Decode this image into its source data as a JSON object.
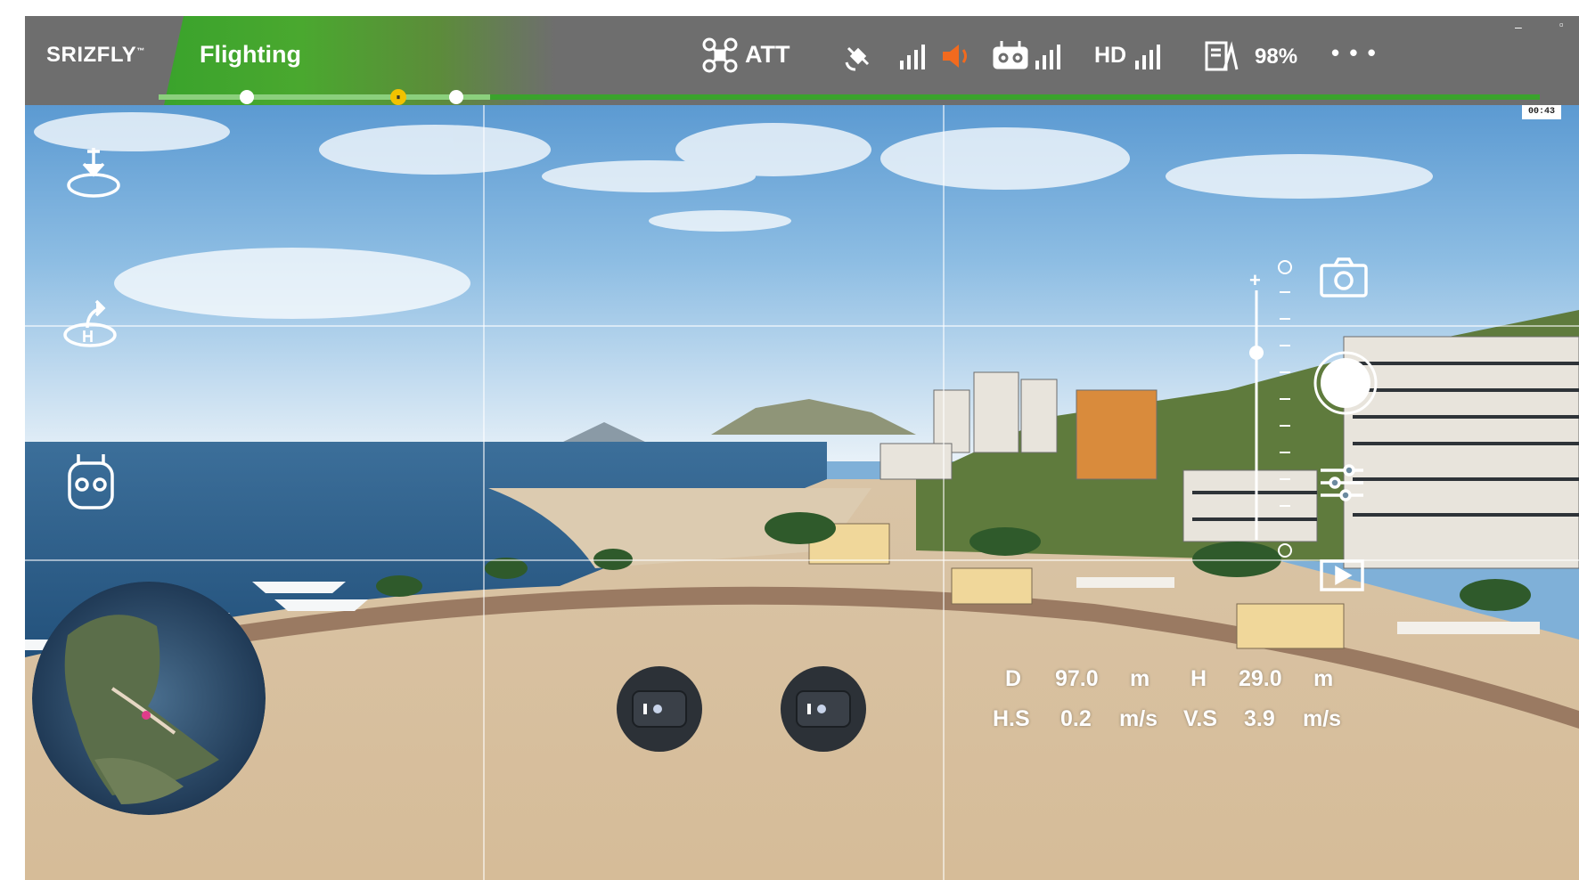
{
  "header": {
    "brand": "SRIZFLY",
    "brand_mark": "™",
    "mode": "Flighting",
    "flight_mode": "ATT",
    "video_quality": "HD",
    "battery_percent": "98%",
    "more_menu": "• • •",
    "timer": "00:43",
    "signal_icons": [
      "satellite-icon",
      "gps-signal-bars-icon",
      "speaker-icon",
      "remote-controller-icon",
      "rc-signal-bars-icon",
      "hd-signal-bars-icon",
      "battery-icon"
    ],
    "window_controls": [
      "–",
      "▫"
    ]
  },
  "mission_progress": {
    "completed_fraction": 0.24,
    "waypoints": [
      "waypoint-1",
      "pause-waypoint",
      "waypoint-2"
    ]
  },
  "left_tools": [
    "takeoff-icon",
    "return-home-icon",
    "controller-icon"
  ],
  "right_tools": [
    "camera-switch-icon",
    "shutter-button",
    "camera-settings-icon",
    "media-playback-icon"
  ],
  "exposure_slider": {
    "plus": "+",
    "level": 0.75
  },
  "telemetry": {
    "distance": {
      "label": "D",
      "value": "97.0",
      "unit": "m"
    },
    "height": {
      "label": "H",
      "value": "29.0",
      "unit": "m"
    },
    "horizontal_speed": {
      "label": "H.S",
      "value": "0.2",
      "unit": "m/s"
    },
    "vertical_speed": {
      "label": "V.S",
      "value": "3.9",
      "unit": "m/s"
    }
  },
  "colors": {
    "accent_green": "#3aa32c",
    "topbar_gray": "#6e6e6e",
    "waypoint_yellow": "#f2c200",
    "alert_orange": "#f26a1e"
  }
}
